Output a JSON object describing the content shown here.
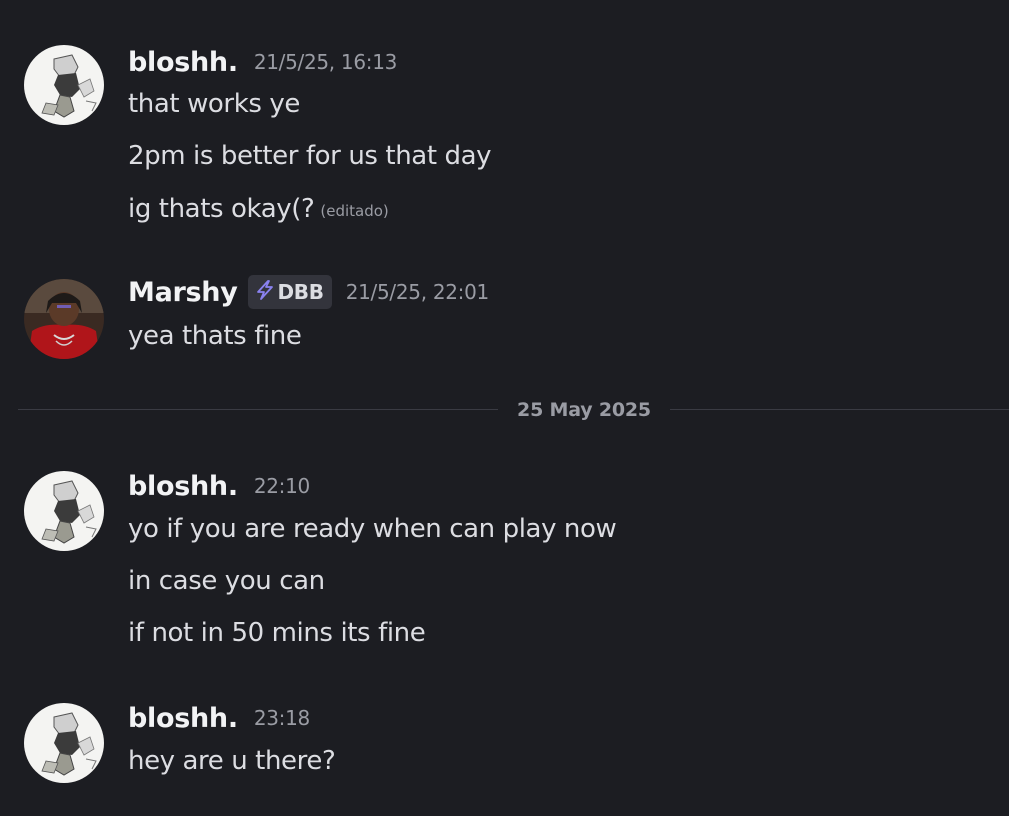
{
  "messages": [
    {
      "avatar": "bloshh-avatar",
      "username": "bloshh.",
      "timestamp": "21/5/25, 16:13",
      "lines": [
        "that works ye",
        "2pm is better for us that day",
        "ig thats okay(?"
      ],
      "edited_label": "(editado)"
    },
    {
      "avatar": "marshy-avatar",
      "username": "Marshy",
      "tag": {
        "icon": "lightning-bolt-icon",
        "label": "DBB",
        "icon_color": "#8a82f0"
      },
      "timestamp": "21/5/25, 22:01",
      "lines": [
        "yea thats fine"
      ]
    },
    {
      "avatar": "bloshh-avatar",
      "username": "bloshh.",
      "timestamp": "22:10",
      "lines": [
        "yo if you are ready when can play now",
        "in case you can",
        "if not in 50 mins its fine"
      ]
    },
    {
      "avatar": "bloshh-avatar",
      "username": "bloshh.",
      "timestamp": "23:18",
      "lines": [
        "hey are u there?"
      ]
    }
  ],
  "date_divider": "25 May 2025",
  "colors": {
    "background": "#1c1d22",
    "username": "#f2f3f5",
    "message_text": "#dcdde2",
    "muted": "#9a9ca4",
    "tag_background": "#33343c"
  }
}
